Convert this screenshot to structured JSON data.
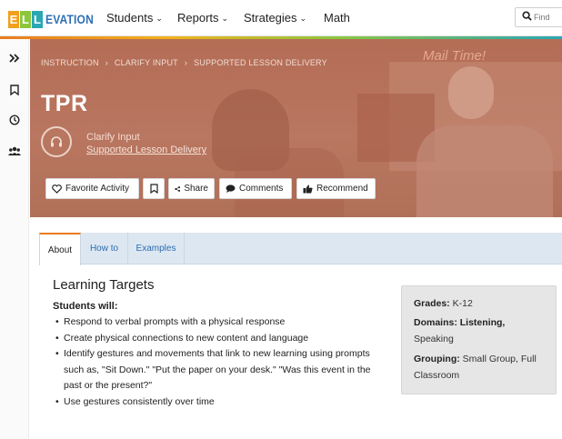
{
  "brand": {
    "logo_letters": [
      "E",
      "L",
      "L"
    ],
    "logo_rest": "EVATION",
    "colors": [
      "#f29f1c",
      "#8cc63f",
      "#2aa7b5"
    ]
  },
  "nav": {
    "items": [
      "Students",
      "Reports",
      "Strategies",
      "Math"
    ],
    "search_placeholder": "Find"
  },
  "rail": {
    "icons": [
      "expand-icon",
      "bookmark-icon",
      "history-icon",
      "group-icon"
    ]
  },
  "hero": {
    "breadcrumb": [
      "INSTRUCTION",
      "CLARIFY INPUT",
      "SUPPORTED LESSON DELIVERY"
    ],
    "breadcrumb_separator": "›",
    "background_sign": "Mail Time!",
    "title": "TPR",
    "category": "Clarify Input",
    "subcategory": "Supported Lesson Delivery",
    "actions": [
      "Favorite Activity",
      "",
      "Share",
      "Comments",
      "Recommend"
    ]
  },
  "tabs": [
    "About",
    "How to",
    "Examples"
  ],
  "about": {
    "heading": "Learning Targets",
    "students_label": "Students will:",
    "targets": [
      "Respond to verbal prompts with a physical response",
      "Create physical connections to new content and language",
      "Identify gestures and movements that link to new learning using prompts such as, \"Sit Down.\" \"Put the paper on your desk.\" \"Was this event in the past or the present?\"",
      "Use gestures consistently over time"
    ]
  },
  "info": {
    "grades_label": "Grades:",
    "grades_value": " K-12",
    "domains_label": "Domains: Listening,",
    "domains_value": "Speaking",
    "grouping_label": "Grouping:",
    "grouping_value": " Small Group, Full",
    "grouping_value2": "Classroom"
  }
}
